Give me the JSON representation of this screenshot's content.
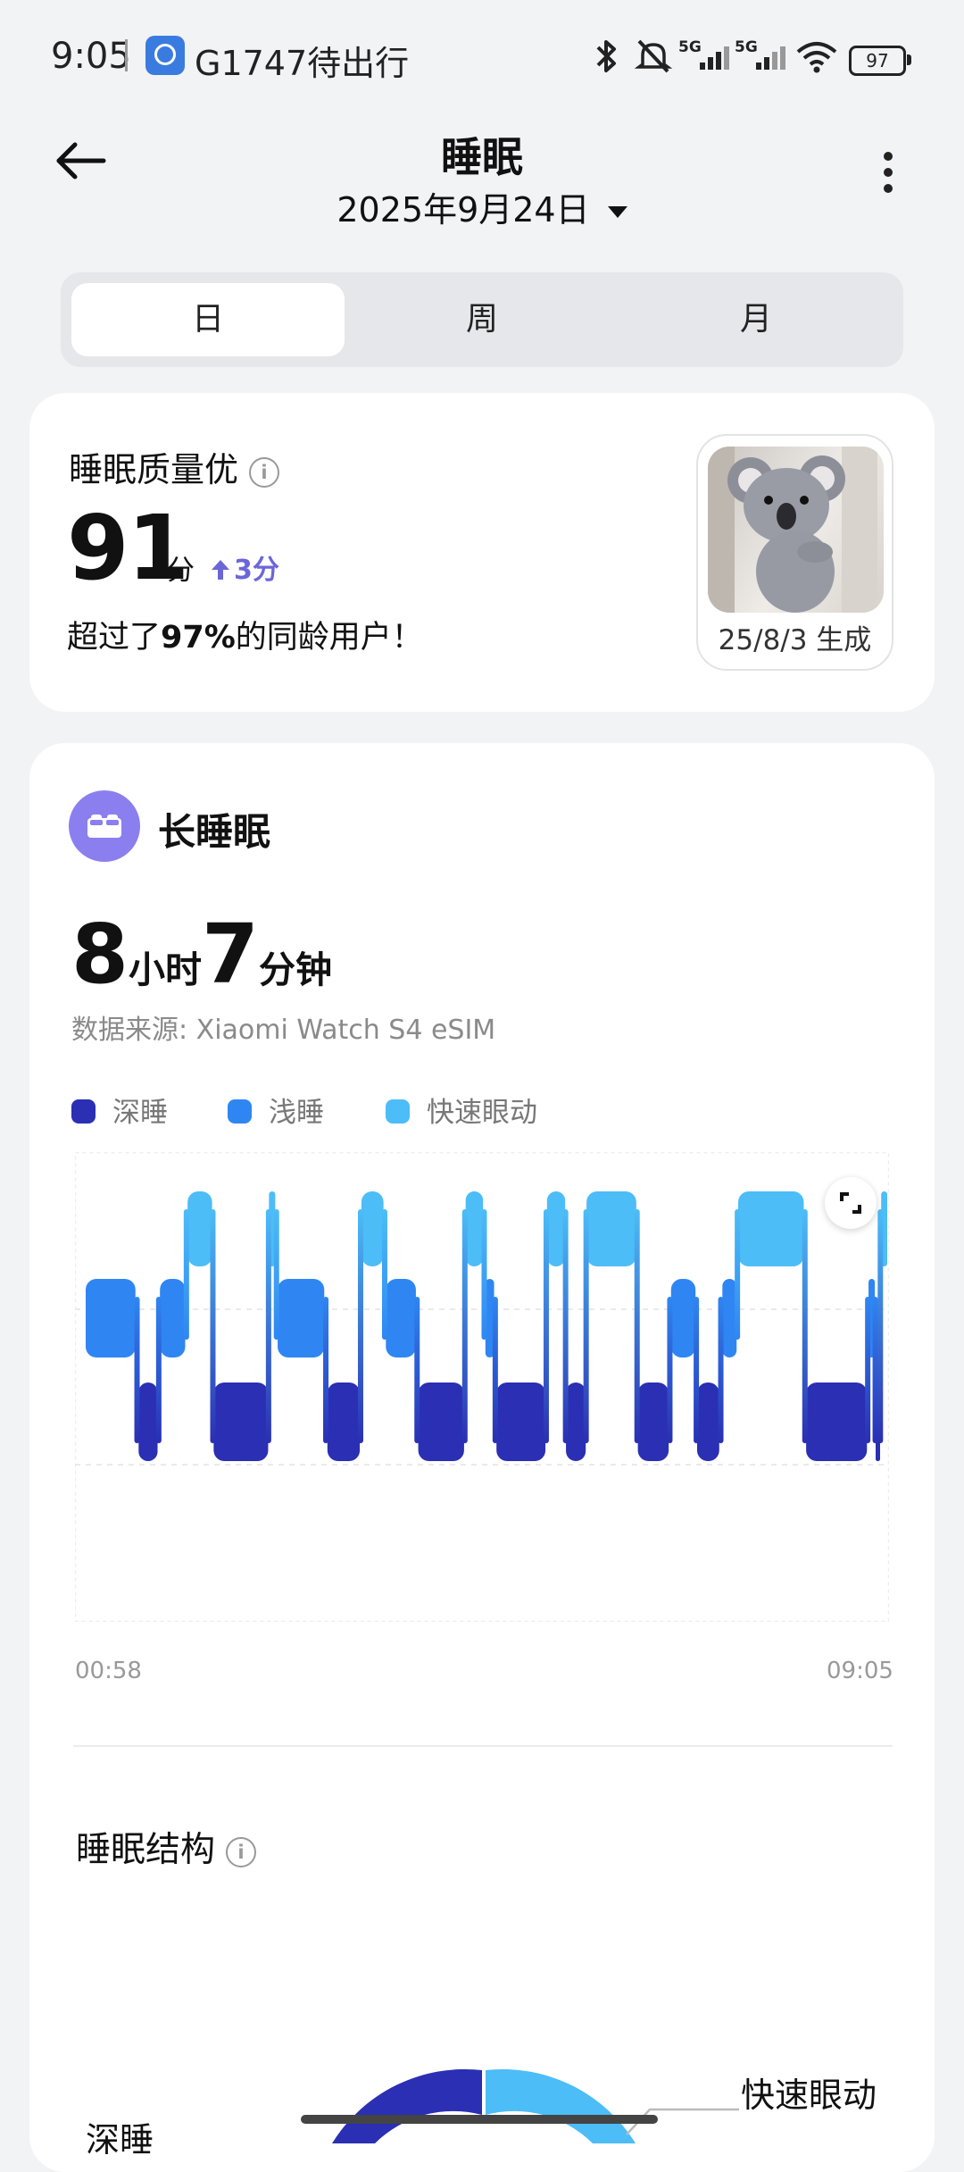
{
  "status_bar": {
    "time": "9:05",
    "notification": "G1747待出行",
    "battery": "97",
    "icons": [
      "bluetooth-icon",
      "mute-icon",
      "5g-signal-icon",
      "5g-signal-icon",
      "wifi-icon",
      "battery-icon"
    ]
  },
  "header": {
    "title": "睡眠",
    "date": "2025年9月24日"
  },
  "tabs": [
    {
      "label": "日",
      "active": true
    },
    {
      "label": "周",
      "active": false
    },
    {
      "label": "月",
      "active": false
    }
  ],
  "quality": {
    "label": "睡眠质量优",
    "score": "91",
    "unit": "分",
    "delta": "3分",
    "exceed_prefix": "超过了",
    "exceed_percent": "97%",
    "exceed_suffix": "的同龄用户！",
    "badge_caption": "25/8/3 生成"
  },
  "long_sleep": {
    "label": "长睡眠",
    "hours": "8",
    "hours_unit": "小时",
    "minutes": "7",
    "minutes_unit": "分钟",
    "source": "数据来源: Xiaomi Watch S4 eSIM"
  },
  "legend": [
    {
      "label": "深睡",
      "color": "#2a2fb3"
    },
    {
      "label": "浅睡",
      "color": "#2f86f2"
    },
    {
      "label": "快速眼动",
      "color": "#4cbdf7"
    }
  ],
  "chart_data": {
    "type": "hypnogram",
    "x_start": "00:58",
    "x_end": "09:05",
    "stages": [
      "快速眼动",
      "浅睡",
      "深睡"
    ],
    "segments": [
      {
        "stage": "浅睡",
        "start": 0.0,
        "end": 0.063
      },
      {
        "stage": "深睡",
        "start": 0.067,
        "end": 0.091
      },
      {
        "stage": "浅睡",
        "start": 0.094,
        "end": 0.126
      },
      {
        "stage": "快速眼动",
        "start": 0.129,
        "end": 0.16
      },
      {
        "stage": "深睡",
        "start": 0.162,
        "end": 0.231
      },
      {
        "stage": "快速眼动",
        "start": 0.232,
        "end": 0.24
      },
      {
        "stage": "浅睡",
        "start": 0.243,
        "end": 0.302
      },
      {
        "stage": "深睡",
        "start": 0.306,
        "end": 0.347
      },
      {
        "stage": "快速眼动",
        "start": 0.349,
        "end": 0.377
      },
      {
        "stage": "浅睡",
        "start": 0.38,
        "end": 0.418
      },
      {
        "stage": "深睡",
        "start": 0.421,
        "end": 0.479
      },
      {
        "stage": "快速眼动",
        "start": 0.481,
        "end": 0.503
      },
      {
        "stage": "浅睡",
        "start": 0.506,
        "end": 0.517
      },
      {
        "stage": "深睡",
        "start": 0.52,
        "end": 0.582
      },
      {
        "stage": "快速眼动",
        "start": 0.584,
        "end": 0.607
      },
      {
        "stage": "深睡",
        "start": 0.608,
        "end": 0.633
      },
      {
        "stage": "快速眼动",
        "start": 0.634,
        "end": 0.697
      },
      {
        "stage": "深睡",
        "start": 0.699,
        "end": 0.738
      },
      {
        "stage": "浅睡",
        "start": 0.741,
        "end": 0.772
      },
      {
        "stage": "深睡",
        "start": 0.774,
        "end": 0.802
      },
      {
        "stage": "浅睡",
        "start": 0.806,
        "end": 0.824
      },
      {
        "stage": "快速眼动",
        "start": 0.826,
        "end": 0.909
      },
      {
        "stage": "深睡",
        "start": 0.912,
        "end": 0.989
      },
      {
        "stage": "浅睡",
        "start": 0.991,
        "end": 0.999
      },
      {
        "stage": "深睡",
        "start": 1.0,
        "end": 1.005
      },
      {
        "stage": "快速眼动",
        "start": 1.007,
        "end": 1.019
      }
    ]
  },
  "structure": {
    "title": "睡眠结构",
    "label_rem": "快速眼动",
    "label_deep": "深睡"
  }
}
